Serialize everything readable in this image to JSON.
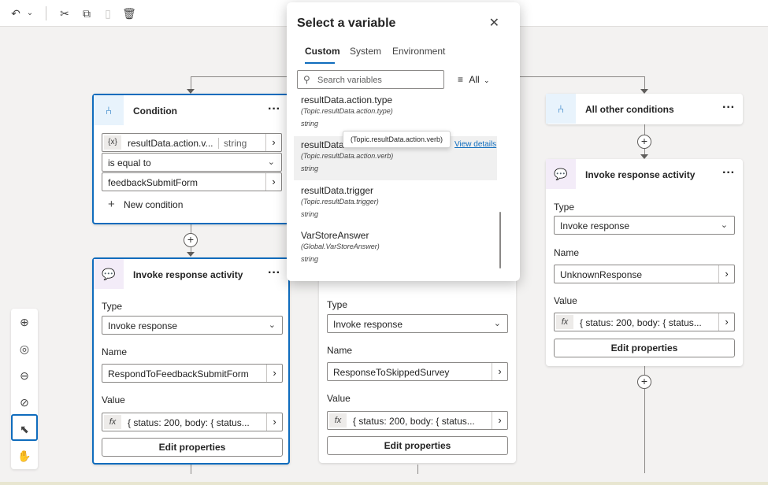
{
  "condition_card": {
    "title": "Condition",
    "variable": "resultData.action.v...",
    "variable_type": "string",
    "operator": "is equal to",
    "value": "feedbackSubmitForm",
    "new_condition": "New condition"
  },
  "other_card": {
    "title": "All other conditions"
  },
  "invoke_left": {
    "title": "Invoke response activity",
    "type_label": "Type",
    "type_value": "Invoke response",
    "name_label": "Name",
    "name_value": "RespondToFeedbackSubmitForm",
    "value_label": "Value",
    "value_text": "{ status: 200, body: { status...",
    "edit": "Edit properties"
  },
  "invoke_mid": {
    "type_label": "Type",
    "type_value": "Invoke response",
    "name_label": "Name",
    "name_value": "ResponseToSkippedSurvey",
    "value_label": "Value",
    "value_text": "{ status: 200, body: { status...",
    "edit": "Edit properties"
  },
  "invoke_right": {
    "title": "Invoke response activity",
    "type_label": "Type",
    "type_value": "Invoke response",
    "name_label": "Name",
    "name_value": "UnknownResponse",
    "value_label": "Value",
    "value_text": "{ status: 200, body: { status...",
    "edit": "Edit properties"
  },
  "popup": {
    "title": "Select a variable",
    "tabs": [
      "Custom",
      "System",
      "Environment"
    ],
    "search_placeholder": "Search variables",
    "filter_label": "All",
    "variables": [
      {
        "name": "resultData.action.type",
        "path": "(Topic.resultData.action.type)",
        "type": "string"
      },
      {
        "name": "resultData.a",
        "path": "(Topic.resultData.action.verb)",
        "type": "string"
      },
      {
        "name": "resultData.trigger",
        "path": "(Topic.resultData.trigger)",
        "type": "string"
      },
      {
        "name": "VarStoreAnswer",
        "path": "(Global.VarStoreAnswer)",
        "type": "string"
      }
    ],
    "view_details": "View details",
    "tooltip": "(Topic.resultData.action.verb)"
  },
  "fx_symbol": "fx",
  "var_symbol": "{x}",
  "colors": {
    "accent": "#0f6cbd",
    "condition_icon_bg": "#e8f3fc",
    "invoke_icon_bg": "#f3ecf8"
  }
}
